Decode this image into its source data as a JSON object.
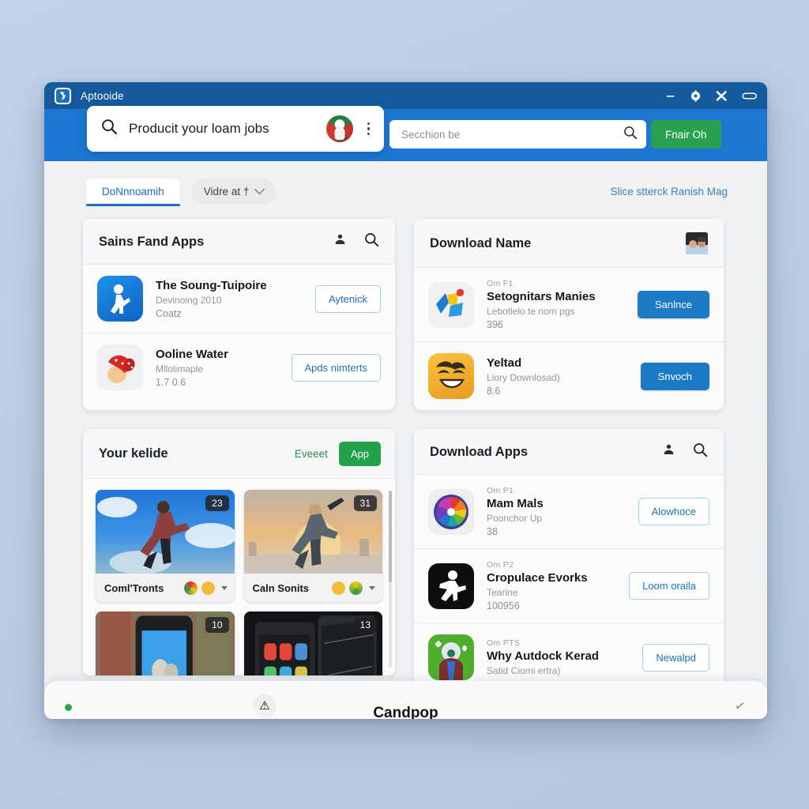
{
  "window": {
    "title": "Aptooide",
    "logo_icon": "aptoide-logo-icon",
    "controls": [
      {
        "name": "minimize-button",
        "glyph": "—"
      },
      {
        "name": "settings-button",
        "glyph": "⚙"
      },
      {
        "name": "close-button",
        "glyph": "✖"
      },
      {
        "name": "maximize-button",
        "glyph": "▭"
      }
    ]
  },
  "toolbar": {
    "omnibox": {
      "icon": "search-icon",
      "value": "Producit your loam jobs",
      "avatar_name": "user-avatar",
      "menu_icon": "kebab-menu-icon"
    },
    "search": {
      "placeholder": "Secchion be",
      "icon": "search-icon"
    },
    "cta_label": "Fnair Oh"
  },
  "tabs": {
    "active_label": "DoNnnoamih",
    "dropdown_label": "Vidre at †",
    "right_link": "Slice stterck Ranish Mag"
  },
  "cards": {
    "sains_fand_apps": {
      "title": "Sains Fand Apps",
      "head_icons": [
        "person-icon",
        "search-icon"
      ],
      "rows": [
        {
          "icon": "running-person-blue-icon",
          "pre": "",
          "name": "The Soung-Tuipoire",
          "sub": "Devinoing 2010",
          "num": "Coatz",
          "action": "Aytenick",
          "action_style": "outline"
        },
        {
          "icon": "red-bow-acorn-icon",
          "pre": "",
          "name": "Ooline Water",
          "sub": "Mllolimaple",
          "num": "1.7 0.6",
          "action": "Apds nimterts",
          "action_style": "outline"
        }
      ]
    },
    "download_name": {
      "title": "Download Name",
      "head_icons": [
        "photo-thumbnail-icon"
      ],
      "rows": [
        {
          "icon": "colorful-shapes-icon",
          "pre": "Om F1",
          "name": "Setognitars Manies",
          "sub": "Lebotlelo te nom pgs",
          "num": "396",
          "action": "Sanlnce",
          "action_style": "solid"
        },
        {
          "icon": "smiling-emoji-icon",
          "pre": "",
          "name": "Yeltad",
          "sub": "Liory Downlosad)",
          "num": "8.6",
          "action": "Snvoch",
          "action_style": "solid"
        }
      ]
    },
    "your_kelide": {
      "title": "Your kelide",
      "link_label": "Eveeet",
      "button_label": "App",
      "thumbs": [
        {
          "label": "Coml'Tronts",
          "badge": "23",
          "scene": "blue-sky-jumper",
          "emojis": [
            "rainbow-emoji",
            "grin-emoji"
          ]
        },
        {
          "label": "Caln Sonits",
          "badge": "31",
          "scene": "sunset-runner",
          "emojis": [
            "smirk-emoji",
            "wink-emoji"
          ]
        },
        {
          "label": "",
          "badge": "10",
          "scene": "phone-photo-hands",
          "emojis": []
        },
        {
          "label": "",
          "badge": "13",
          "scene": "broken-phone-screens",
          "emojis": []
        }
      ]
    },
    "download_apps": {
      "title": "Download Apps",
      "head_icons": [
        "person-icon",
        "search-icon"
      ],
      "rows": [
        {
          "icon": "rainbow-wheel-icon",
          "pre": "Om P1",
          "name": "Mam Mals",
          "sub": "Poonchor Up",
          "num": "38",
          "action": "Alowhoce",
          "action_style": "outline"
        },
        {
          "icon": "black-runner-icon",
          "pre": "Om P2",
          "name": "Cropulace Evorks",
          "sub": "Tearine",
          "num": "100956",
          "action": "Loom oraila",
          "action_style": "outline"
        },
        {
          "icon": "green-character-icon",
          "pre": "Om PTS",
          "name": "Why Autdock Kerad",
          "sub": "Satid Ciomi ertra)",
          "num": "",
          "action": "Newalpd",
          "action_style": "outline"
        }
      ]
    }
  },
  "bottom_sheet": {
    "title": "Candpop",
    "badge_glyph": "⚠",
    "right_glyph": "✓"
  },
  "colors": {
    "titlebar": "#15599f",
    "toolbar": "#1d77d2",
    "accent_blue": "#1a72c0",
    "accent_green": "#27a250",
    "page_bg": "#eff1f3"
  }
}
